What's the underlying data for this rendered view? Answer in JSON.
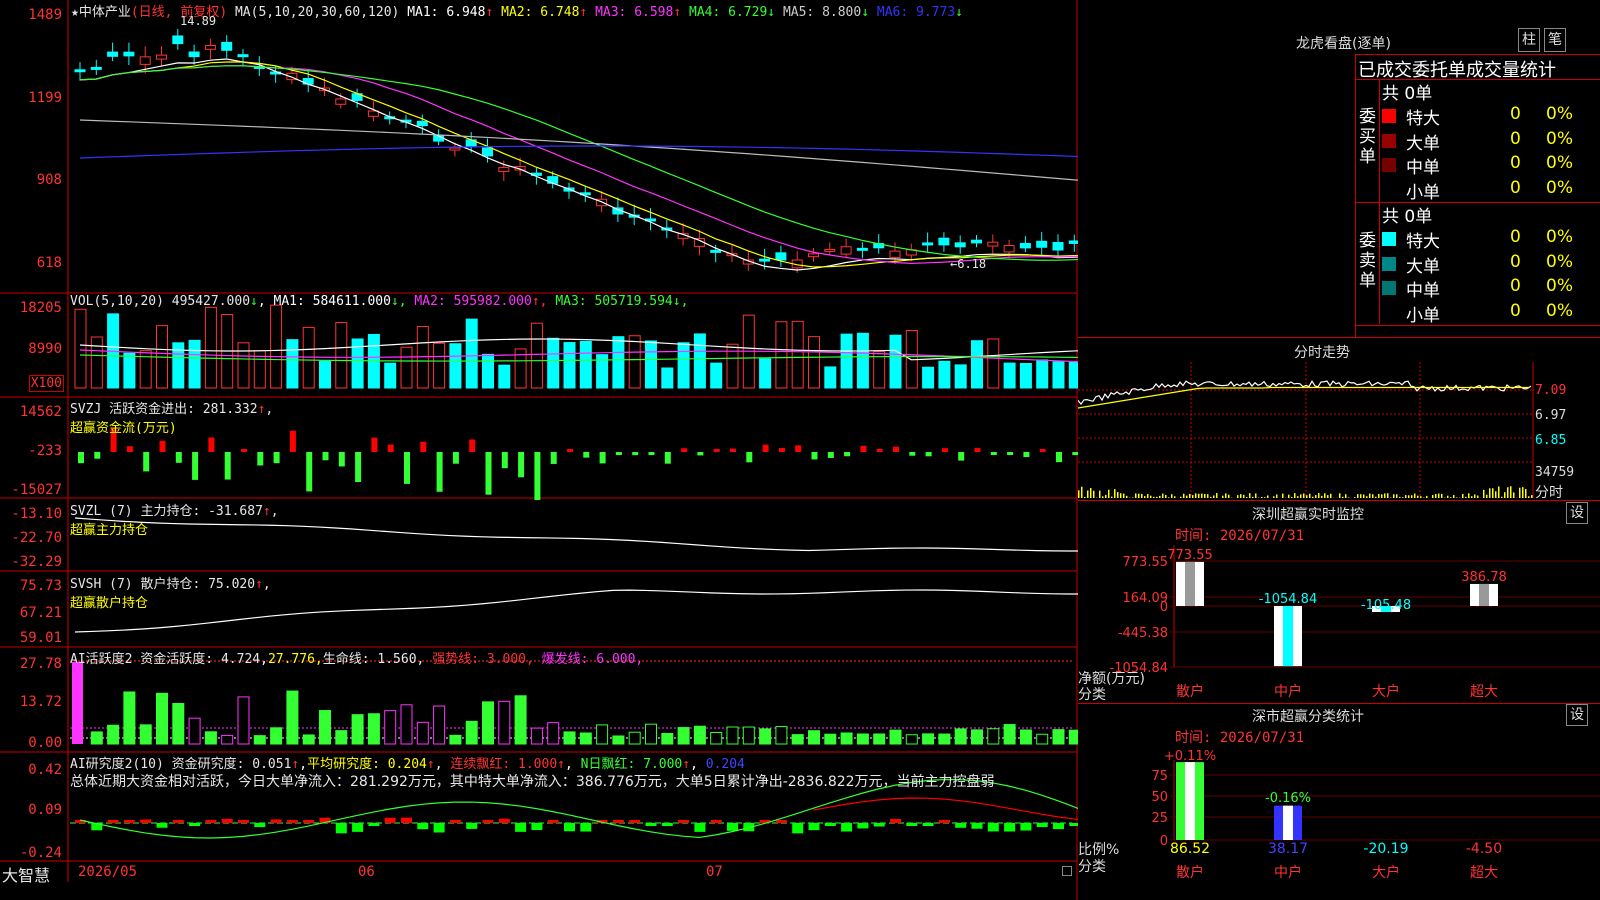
{
  "stock": {
    "name": "中体产业",
    "period": "(日线, 前复权)",
    "star": "★"
  },
  "footer": {
    "brand": "大智慧",
    "dates": [
      "2026/05",
      "06",
      "07"
    ]
  },
  "main_chart": {
    "high_marker": "14.89",
    "low_marker": "6.18",
    "yticks": [
      "1489",
      "1199",
      "908",
      "618"
    ],
    "ma_label": "MA(5,10,20,30,60,120)",
    "ma": [
      {
        "k": "MA1",
        "v": "6.948",
        "a": "↑",
        "c": "#ffffff"
      },
      {
        "k": "MA2",
        "v": "6.748",
        "a": "↑",
        "c": "#ffff00"
      },
      {
        "k": "MA3",
        "v": "6.598",
        "a": "↑",
        "c": "#ff33ff"
      },
      {
        "k": "MA4",
        "v": "6.729",
        "a": "↓",
        "c": "#33ff33"
      },
      {
        "k": "MA5",
        "v": "8.800",
        "a": "↓",
        "c": "#cccccc"
      },
      {
        "k": "MA6",
        "v": "9.773",
        "a": "↓",
        "c": "#3333ff"
      }
    ]
  },
  "vol_panel": {
    "label": "VOL(5,10,20)",
    "value": "495427.000",
    "arrow": "↓",
    "ma": [
      {
        "k": "MA1",
        "v": "584611.000",
        "a": "↓",
        "c": "#ffffff"
      },
      {
        "k": "MA2",
        "v": "595982.000",
        "a": "↑",
        "c": "#ff33ff"
      },
      {
        "k": "MA3",
        "v": "505719.594",
        "a": "↓",
        "c": "#33ff33"
      }
    ],
    "yticks": [
      "18205",
      "8990"
    ],
    "unit": "X100"
  },
  "svzj_panel": {
    "label": "SVZJ  活跃资金进出:",
    "value": "281.332",
    "arrow": "↑",
    "suffix": ",",
    "sub": "超赢资金流(万元)",
    "yticks": [
      "14562",
      "-233",
      "-15027"
    ]
  },
  "svzl_panel": {
    "label": "SVZL (7) 主力持仓:",
    "value": "-31.687",
    "arrow": "↑",
    "suffix": ",",
    "sub": "超赢主力持仓",
    "yticks": [
      "-13.10",
      "-22.70",
      "-32.29"
    ]
  },
  "svsh_panel": {
    "label": "SVSH (7) 散户持仓:",
    "value": "75.020",
    "arrow": "↑",
    "suffix": ",",
    "sub": "超赢散户持仓",
    "yticks": [
      "75.73",
      "67.21",
      "59.01"
    ]
  },
  "ai_activity": {
    "label": "AI活跃度2 资金活跃度:",
    "value": "4.724",
    "v2": "27.776,",
    "life_label": "生命线:",
    "life": "1.560,",
    "strong_label": "强势线:",
    "strong": "3.000,",
    "burst_label": "爆发线:",
    "burst": "6.000,",
    "yticks": [
      "27.78",
      "13.72",
      "0.00"
    ]
  },
  "ai_research": {
    "label": "AI研究度2(10) 资金研究度:",
    "value": "0.051",
    "avg_label": "平均研究度:",
    "avg": "0.204",
    "streak_label": "连续飘红:",
    "streak": "1.000",
    "nday_label": "N日飘红:",
    "nday": "7.000",
    "last": "0.204",
    "summary": "总体近期大资金相对活跃，今日大单净流入：281.292万元，其中特大单净流入：386.776万元，大单5日累计净出-2836.822万元，当前主力控盘弱",
    "yticks": [
      "0.42",
      "0.09",
      "-0.24"
    ]
  },
  "right": {
    "title": "龙虎看盘(逐单)",
    "btn_zhu": "柱",
    "btn_bi": "笔",
    "stat_title": "已成交委托单成交量统计",
    "buy": {
      "label": "委买单",
      "total": "共 0单",
      "rows": [
        {
          "name": "特大",
          "n": "0",
          "p": "0%",
          "c": "#ff0000"
        },
        {
          "name": "大单",
          "n": "0",
          "p": "0%",
          "c": "#990000"
        },
        {
          "name": "中单",
          "n": "0",
          "p": "0%",
          "c": "#770000"
        },
        {
          "name": "小单",
          "n": "0",
          "p": "0%",
          "c": ""
        }
      ]
    },
    "sell": {
      "label": "委卖单",
      "total": "共 0单",
      "rows": [
        {
          "name": "特大",
          "n": "0",
          "p": "0%",
          "c": "#00ffff"
        },
        {
          "name": "大单",
          "n": "0",
          "p": "0%",
          "c": "#008888"
        },
        {
          "name": "中单",
          "n": "0",
          "p": "0%",
          "c": "#007777"
        },
        {
          "name": "小单",
          "n": "0",
          "p": "0%",
          "c": ""
        }
      ]
    },
    "intraday": {
      "title": "分时走势",
      "prices": [
        "7.09",
        "6.97",
        "6.85"
      ],
      "volume": "34759",
      "label": "分时"
    },
    "sz_monitor": {
      "title": "深圳超赢实时监控",
      "set": "设",
      "time": "时间: 2026/07/31",
      "yticks": [
        "773.55",
        "164.09",
        "0",
        "-445.38",
        "-1054.84"
      ],
      "ylabel": "净额(万元)",
      "xlabel": "分类",
      "chart_data": {
        "type": "bar",
        "categories": [
          "散户",
          "中户",
          "大户",
          "超大"
        ],
        "values": [
          773.55,
          -1054.84,
          -105.48,
          386.78
        ],
        "labels": [
          "773.55",
          "-1054.84",
          "-105.48",
          "386.78"
        ]
      }
    },
    "sz_class": {
      "title": "深市超赢分类统计",
      "set": "设",
      "time": "时间: 2026/07/31",
      "yticks": [
        "75",
        "50",
        "25",
        "0"
      ],
      "ylabel": "比例%",
      "xlabel": "分类",
      "chart_data": {
        "type": "bar",
        "categories": [
          "散户",
          "中户",
          "大户",
          "超大"
        ],
        "top_labels": [
          "+0.11%",
          "-0.16%",
          "",
          ""
        ],
        "values": [
          86.52,
          38.17,
          -20.19,
          -4.5
        ],
        "value_labels": [
          "86.52",
          "38.17",
          "-20.19",
          "-4.50"
        ]
      }
    }
  },
  "colors": {
    "up": "#ff3333",
    "down": "#00ffff",
    "grid": "#cc0000"
  }
}
